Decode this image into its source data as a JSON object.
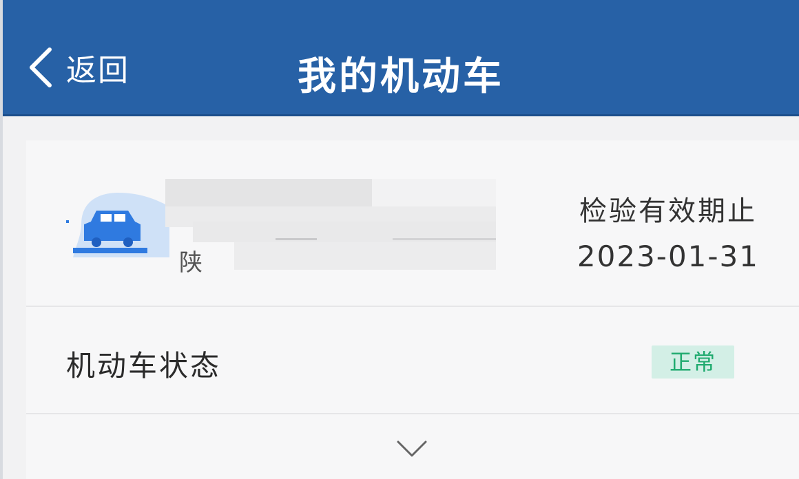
{
  "header": {
    "back_label": "返回",
    "title": "我的机动车"
  },
  "vehicle": {
    "plate_partial": "陕",
    "inspection_label": "检验有效期止",
    "inspection_date": "2023-01-31"
  },
  "status": {
    "label": "机动车状态",
    "value": "正常"
  },
  "icons": {
    "back": "chevron-left-icon",
    "vehicle": "car-icon",
    "expand": "chevron-down-icon"
  },
  "colors": {
    "header_bg": "#2761a6",
    "badge_bg": "#d3efe6",
    "badge_text": "#1faa6e",
    "car_icon": "#2f7ae0"
  }
}
